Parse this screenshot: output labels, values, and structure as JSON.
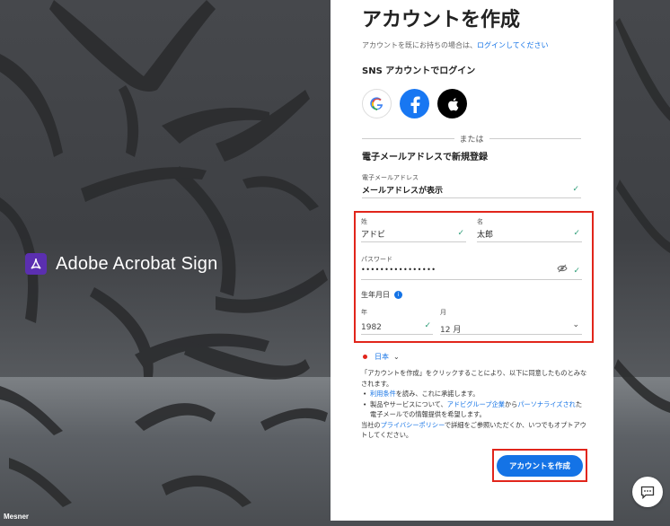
{
  "brand": {
    "name": "Adobe Acrobat Sign"
  },
  "watermark": "Mesner",
  "form": {
    "title": "アカウントを作成",
    "signin_prefix": "アカウントを既にお持ちの場合は、",
    "signin_link": "ログインしてください",
    "sns_heading": "SNS アカウントでログイン",
    "sns_buttons": [
      "google-icon",
      "facebook-icon",
      "apple-icon"
    ],
    "divider_text": "または",
    "new_heading": "電子メールアドレスで新規登録",
    "email": {
      "label": "電子メールアドレス",
      "value": "メールアドレスが表示"
    },
    "last_name": {
      "label": "姓",
      "value": "アドビ"
    },
    "first_name": {
      "label": "名",
      "value": "太郎"
    },
    "password": {
      "label": "パスワード",
      "value": "••••••••••••••••"
    },
    "dob": {
      "label": "生年月日",
      "year_label": "年",
      "year_value": "1982",
      "month_label": "月",
      "month_value": "12 月"
    },
    "country": "日本",
    "terms": {
      "intro": "「アカウントを作成」をクリックすることにより、以下に同意したものとみなされます。",
      "b1_link": "利用条件",
      "b1_text": "を読み、これに承諾します。",
      "b2_prefix": "製品やサービスについて、",
      "b2_link1": "アドビグループ企業",
      "b2_mid": "から",
      "b2_link2": "パーソナライズされ",
      "b2_suffix": "た電子メールでの情報提供を希望します。",
      "outro_prefix": "当社の",
      "outro_link": "プライバシーポリシー",
      "outro_suffix": "で詳細をご参照いただくか、いつでもオプトアウトしてください。"
    },
    "create_button": "アカウントを作成"
  },
  "colors": {
    "accent": "#1473e6",
    "highlight": "#e1251b",
    "check": "#2d9d78",
    "brand_logo": "#5b2fb0"
  }
}
